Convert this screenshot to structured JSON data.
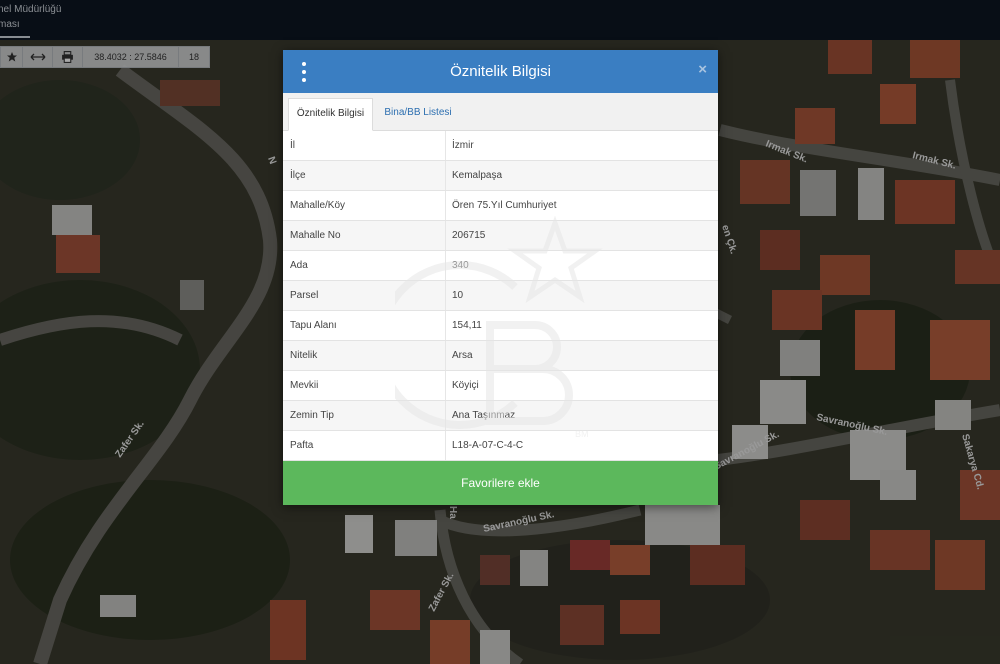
{
  "header": {
    "title_line1": "nel Müdürlüğü",
    "title_line2": "ması"
  },
  "toolbar": {
    "star_icon": "star-icon",
    "measure_icon": "horizontal-arrows-icon",
    "print_icon": "printer-icon",
    "coordinates": "38.4032 : 27.5846",
    "zoom_level": "18"
  },
  "map": {
    "street_labels": [
      "Irmak Sk.",
      "Irmak Sk.",
      "Zafer Sk.",
      "Zafer Sk.",
      "Savranoğlu Sk.",
      "Savranoğlu Sk.",
      "Savranoğlu Sk.",
      "Sakarya Cd.",
      "N",
      "Ha",
      "en Çk."
    ]
  },
  "modal": {
    "title": "Öznitelik Bilgisi",
    "close": "×",
    "tabs": [
      {
        "label": "Öznitelik Bilgisi",
        "active": true
      },
      {
        "label": "Bina/BB Listesi",
        "active": false
      }
    ],
    "rows": [
      {
        "key": "İl",
        "value": "İzmir"
      },
      {
        "key": "İlçe",
        "value": "Kemalpaşa"
      },
      {
        "key": "Mahalle/Köy",
        "value": "Ören 75.Yıl Cumhuriyet"
      },
      {
        "key": "Mahalle No",
        "value": "206715"
      },
      {
        "key": "Ada",
        "value": "340"
      },
      {
        "key": "Parsel",
        "value": "10"
      },
      {
        "key": "Tapu Alanı",
        "value": "154,11"
      },
      {
        "key": "Nitelik",
        "value": "Arsa"
      },
      {
        "key": "Mevkii",
        "value": "Köyiçi"
      },
      {
        "key": "Zemin Tip",
        "value": "Ana Taşınmaz"
      },
      {
        "key": "Pafta",
        "value": "L18-A-07-C-4-C"
      }
    ],
    "add_favorites": "Favorilere ekle"
  },
  "watermark": {
    "mark": "BM"
  },
  "colors": {
    "header_blue": "#3a7ec2",
    "favorites_green": "#5cb85c",
    "tab_link": "#2d6fb0",
    "topbar": "#0d1622"
  }
}
